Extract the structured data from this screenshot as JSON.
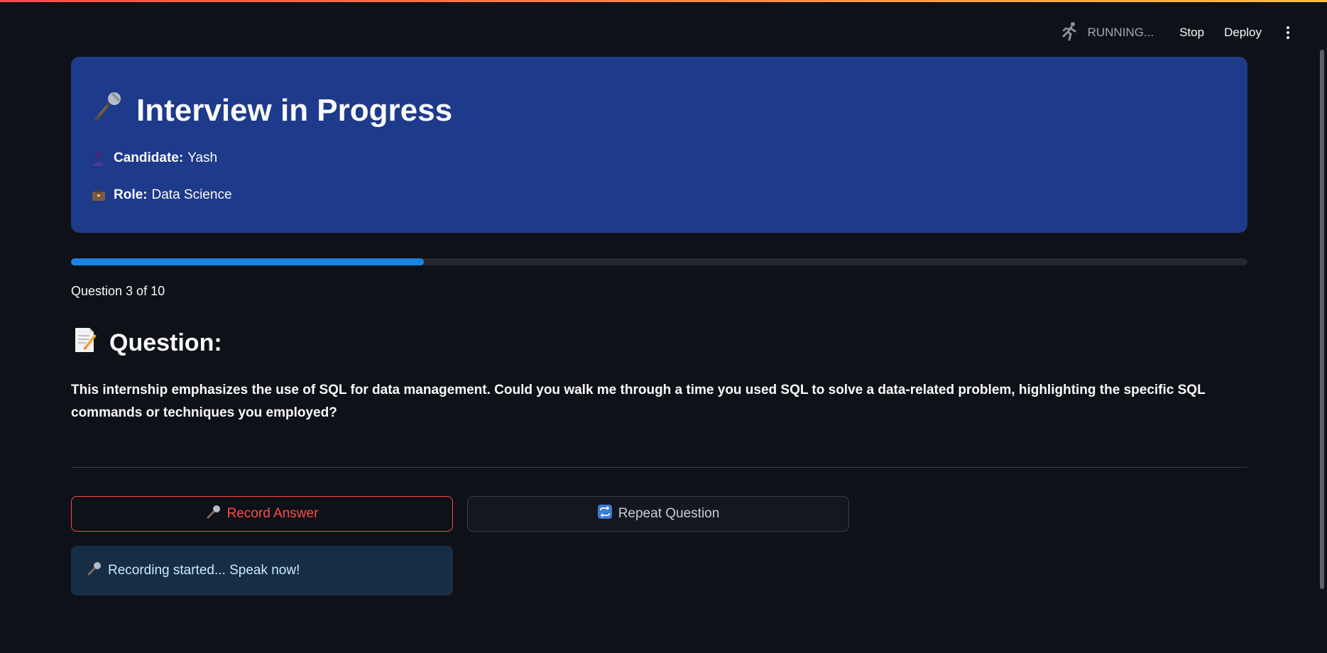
{
  "header": {
    "status_text": "RUNNING...",
    "stop_label": "Stop",
    "deploy_label": "Deploy",
    "status_icon": "running-man-icon",
    "menu_icon": "more-vertical-icon"
  },
  "hero": {
    "title": "Interview in Progress",
    "title_icon": "microphone-icon",
    "candidate_label": "Candidate:",
    "candidate_value": "Yash",
    "candidate_icon": "person-icon",
    "role_label": "Role:",
    "role_value": "Data Science",
    "role_icon": "briefcase-icon",
    "background_color": "#1e3a8a"
  },
  "progress": {
    "current": 3,
    "total": 10,
    "fraction": 0.3,
    "text": "Question 3 of 10",
    "fill_color": "#1c83e1"
  },
  "question": {
    "heading": "Question:",
    "heading_icon": "memo-icon",
    "text": "This internship emphasizes the use of SQL for data management. Could you walk me through a time you used SQL to solve a data-related problem, highlighting the specific SQL commands or techniques you employed?"
  },
  "actions": {
    "record_label": "Record Answer",
    "record_icon": "microphone-icon",
    "repeat_label": "Repeat Question",
    "repeat_icon": "repeat-icon",
    "accent_color": "#ff4b4b"
  },
  "status_message": {
    "text": "Recording started... Speak now!",
    "icon": "microphone-icon"
  }
}
